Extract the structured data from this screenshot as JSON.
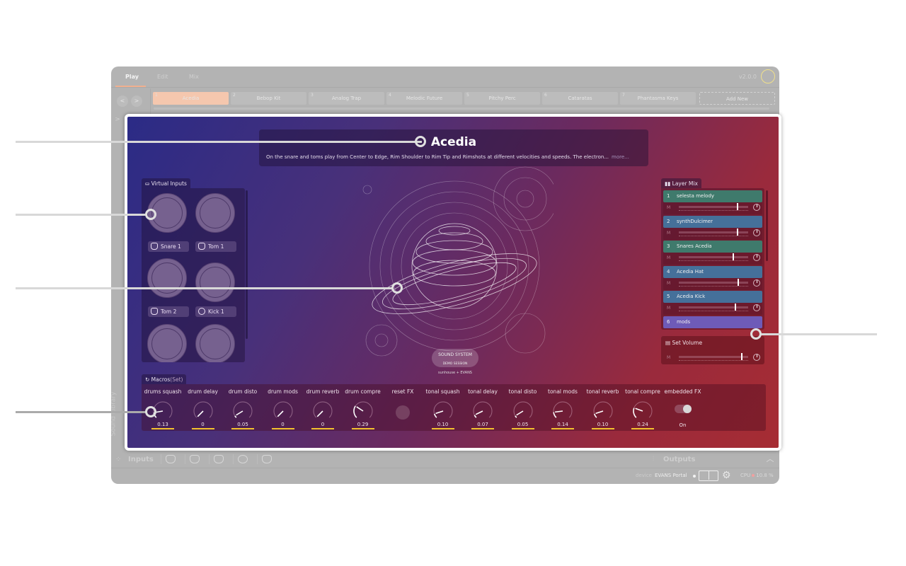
{
  "header": {
    "mode_tabs": [
      {
        "label": "Play",
        "active": true
      },
      {
        "label": "Edit",
        "active": false
      },
      {
        "label": "Mix",
        "active": false
      }
    ],
    "version": "v2.0.0",
    "logo_icon": "sunhouse-logo-icon"
  },
  "presets": {
    "prev_label": "<",
    "next_label": ">",
    "items": [
      {
        "num": "1",
        "name": "Acedia",
        "active": true
      },
      {
        "num": "2",
        "name": "Bebop Kit"
      },
      {
        "num": "3",
        "name": "Analog Trap"
      },
      {
        "num": "4",
        "name": "Melodic Future"
      },
      {
        "num": "5",
        "name": "Pitchy Perc"
      },
      {
        "num": "6",
        "name": "Cataratas"
      },
      {
        "num": "7",
        "name": "Phantasma Keys"
      }
    ],
    "add_label": "Add New"
  },
  "sidebar": {
    "expand_label": ">",
    "sound_library_label": "Sound Library"
  },
  "preset_info": {
    "title": "Acedia",
    "description": "On the snare and toms play from Center to Edge, Rim Shoulder to Rim Tip and Rimshots at different velocities and speeds. The electron...",
    "more_label": "more..."
  },
  "virtual_inputs": {
    "title": "Virtual Inputs",
    "pads": [
      {
        "label": "Snare 1",
        "icon": "snare-drum-icon"
      },
      {
        "label": "Tom 1",
        "icon": "tom-drum-icon"
      },
      {
        "label": "Tom 2",
        "icon": "tom-drum-icon"
      },
      {
        "label": "Kick 1",
        "icon": "kick-drum-icon"
      },
      {
        "label": "",
        "icon": "snare-drum-icon"
      },
      {
        "label": "",
        "icon": "tom-drum-icon"
      }
    ]
  },
  "artwork": {
    "badge_line1": "SOUND SYSTEM",
    "badge_line2": "DEMO SESSION",
    "credit": "sunhouse + EVANS"
  },
  "layer_mix": {
    "title": "Layer Mix",
    "mute_label": "M",
    "layers": [
      {
        "num": "1",
        "name": "selesta melody",
        "color": "#3f7a6c",
        "level": 0.84
      },
      {
        "num": "2",
        "name": "synthDulcimer",
        "color": "#45709a",
        "level": 0.84
      },
      {
        "num": "3",
        "name": "Snares Acedia",
        "color": "#3f7a6c",
        "level": 0.78
      },
      {
        "num": "4",
        "name": "Acedia Hat",
        "color": "#45709a",
        "level": 0.85
      },
      {
        "num": "5",
        "name": "Acedia Kick",
        "color": "#45709a",
        "level": 0.81
      },
      {
        "num": "6",
        "name": "mods",
        "color": "#6e5bb8",
        "level": null
      }
    ],
    "set_volume": {
      "title": "Set Volume",
      "mute_label": "M",
      "level": 0.9
    }
  },
  "macros": {
    "title": "Macros",
    "title_suffix": "(Set)",
    "items": [
      {
        "label": "drums squash",
        "value": "0.13",
        "norm": 0.13
      },
      {
        "label": "drum delay",
        "value": "0",
        "norm": 0
      },
      {
        "label": "drum disto",
        "value": "0.05",
        "norm": 0.05
      },
      {
        "label": "drum mods",
        "value": "0",
        "norm": 0
      },
      {
        "label": "drum reverb",
        "value": "0",
        "norm": 0
      },
      {
        "label": "drum compre",
        "value": "0.29",
        "norm": 0.29
      },
      {
        "label": "reset FX",
        "type": "button"
      },
      {
        "label": "tonal squash",
        "value": "0.10",
        "norm": 0.1
      },
      {
        "label": "tonal delay",
        "value": "0.07",
        "norm": 0.07
      },
      {
        "label": "tonal disto",
        "value": "0.05",
        "norm": 0.05
      },
      {
        "label": "tonal mods",
        "value": "0.14",
        "norm": 0.14
      },
      {
        "label": "tonal reverb",
        "value": "0.10",
        "norm": 0.1
      },
      {
        "label": "tonal compre",
        "value": "0.24",
        "norm": 0.24
      },
      {
        "label": "embedded FX",
        "type": "toggle",
        "state": "On"
      }
    ]
  },
  "bottom": {
    "inputs_label": "Inputs",
    "outputs_label": "Outputs",
    "input_icons": [
      "snare-drum-icon",
      "tom-drum-icon",
      "tom-drum-icon",
      "kick-drum-icon",
      "snare-drum-icon"
    ]
  },
  "status": {
    "device_label": "device",
    "device_name": "EVANS Portal",
    "cpu_label": "CPU",
    "cpu_value": "10.8 %"
  }
}
